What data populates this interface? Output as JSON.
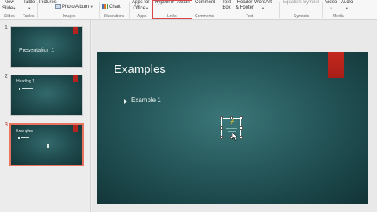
{
  "ribbon": {
    "buttons": {
      "new_slide": "New\nSlide",
      "table": "Table",
      "pictures": "Pictures",
      "photo_album": "Photo Album",
      "chart": "Chart",
      "apps_for_office": "Apps for\nOffice",
      "hyperlink": "Hyperlink",
      "action": "Action",
      "comment": "Comment",
      "text_box": "Text\nBox",
      "header_footer": "Header\n& Footer",
      "wordart": "WordArt",
      "equation": "Equation",
      "symbol": "Symbol",
      "video": "Video",
      "audio": "Audio"
    },
    "groups": {
      "slides": "Slides",
      "tables": "Tables",
      "images": "Images",
      "illustrations": "Illustrations",
      "apps": "Apps",
      "links": "Links",
      "comments": "Comments",
      "text": "Text",
      "symbols": "Symbols",
      "media": "Media"
    }
  },
  "thumbnails": [
    {
      "number": "1",
      "title": "Presentation 1",
      "active": false
    },
    {
      "number": "2",
      "title": "Heading 1",
      "active": false
    },
    {
      "number": "3",
      "title": "Examples",
      "active": true
    }
  ],
  "slide": {
    "title": "Examples",
    "bullets": [
      "Example 1"
    ]
  },
  "colors": {
    "slide_bg": "#1f4a4d",
    "accent_tab": "#b5241c",
    "highlight": "#d9474a",
    "active_thumb_border": "#e8735f"
  }
}
